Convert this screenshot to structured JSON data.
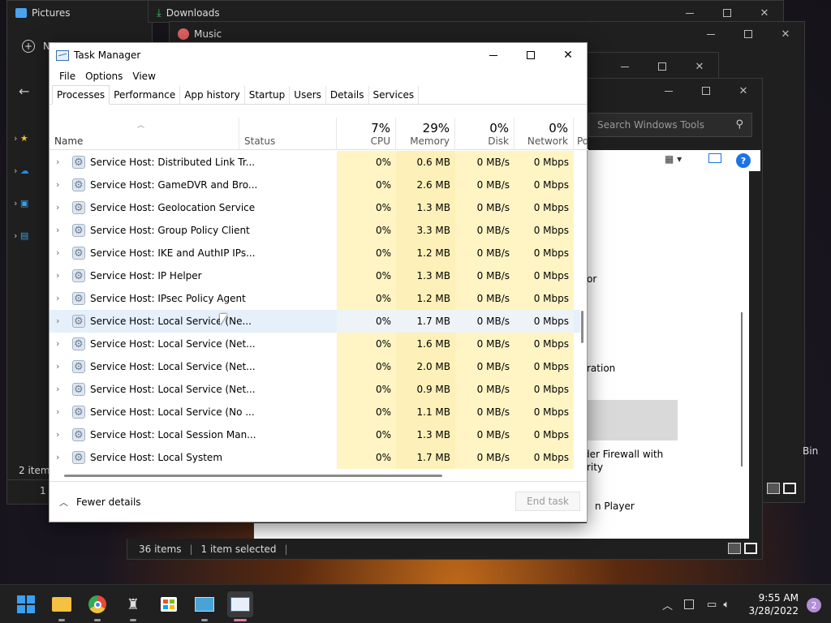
{
  "background_windows": {
    "pictures_title": "Pictures",
    "downloads_title": "Downloads",
    "music_title": "Music",
    "new_button": "N",
    "left_status": "2 items",
    "left_status2": "1",
    "right_fragment": "Bin"
  },
  "tools_window": {
    "search_placeholder": "Search Windows Tools",
    "items": [
      "or",
      "ration",
      "der Firewall with",
      "rity",
      "n Player"
    ],
    "status": {
      "count": "36 items",
      "selected": "1 item selected"
    }
  },
  "task_manager": {
    "title": "Task Manager",
    "menu": [
      "File",
      "Options",
      "View"
    ],
    "tabs": [
      "Processes",
      "Performance",
      "App history",
      "Startup",
      "Users",
      "Details",
      "Services"
    ],
    "active_tab": "Processes",
    "columns": {
      "name": "Name",
      "status": "Status",
      "cpu": {
        "pct": "7%",
        "label": "CPU"
      },
      "memory": {
        "pct": "29%",
        "label": "Memory"
      },
      "disk": {
        "pct": "0%",
        "label": "Disk"
      },
      "network": {
        "pct": "0%",
        "label": "Network"
      },
      "power_partial": "Po"
    },
    "rows": [
      {
        "name": "Service Host: Distributed Link Tr...",
        "cpu": "0%",
        "mem": "0.6 MB",
        "disk": "0 MB/s",
        "net": "0 Mbps"
      },
      {
        "name": "Service Host: GameDVR and Bro...",
        "cpu": "0%",
        "mem": "2.6 MB",
        "disk": "0 MB/s",
        "net": "0 Mbps"
      },
      {
        "name": "Service Host: Geolocation Service",
        "cpu": "0%",
        "mem": "1.3 MB",
        "disk": "0 MB/s",
        "net": "0 Mbps"
      },
      {
        "name": "Service Host: Group Policy Client",
        "cpu": "0%",
        "mem": "3.3 MB",
        "disk": "0 MB/s",
        "net": "0 Mbps"
      },
      {
        "name": "Service Host: IKE and AuthIP IPs...",
        "cpu": "0%",
        "mem": "1.2 MB",
        "disk": "0 MB/s",
        "net": "0 Mbps"
      },
      {
        "name": "Service Host: IP Helper",
        "cpu": "0%",
        "mem": "1.3 MB",
        "disk": "0 MB/s",
        "net": "0 Mbps"
      },
      {
        "name": "Service Host: IPsec Policy Agent",
        "cpu": "0%",
        "mem": "1.2 MB",
        "disk": "0 MB/s",
        "net": "0 Mbps"
      },
      {
        "name": "Service Host: Local Service (Ne...",
        "cpu": "0%",
        "mem": "1.7 MB",
        "disk": "0 MB/s",
        "net": "0 Mbps"
      },
      {
        "name": "Service Host: Local Service (Net...",
        "cpu": "0%",
        "mem": "1.6 MB",
        "disk": "0 MB/s",
        "net": "0 Mbps"
      },
      {
        "name": "Service Host: Local Service (Net...",
        "cpu": "0%",
        "mem": "2.0 MB",
        "disk": "0 MB/s",
        "net": "0 Mbps"
      },
      {
        "name": "Service Host: Local Service (Net...",
        "cpu": "0%",
        "mem": "0.9 MB",
        "disk": "0 MB/s",
        "net": "0 Mbps"
      },
      {
        "name": "Service Host: Local Service (No ...",
        "cpu": "0%",
        "mem": "1.1 MB",
        "disk": "0 MB/s",
        "net": "0 Mbps"
      },
      {
        "name": "Service Host: Local Session Man...",
        "cpu": "0%",
        "mem": "1.3 MB",
        "disk": "0 MB/s",
        "net": "0 Mbps"
      },
      {
        "name": "Service Host: Local System",
        "cpu": "0%",
        "mem": "1.7 MB",
        "disk": "0 MB/s",
        "net": "0 Mbps"
      }
    ],
    "selected_row_index": 7,
    "footer": {
      "fewer_details": "Fewer details",
      "end_task": "End task"
    }
  },
  "taskbar": {
    "time": "9:55 AM",
    "date": "3/28/2022",
    "notification_count": "2"
  }
}
